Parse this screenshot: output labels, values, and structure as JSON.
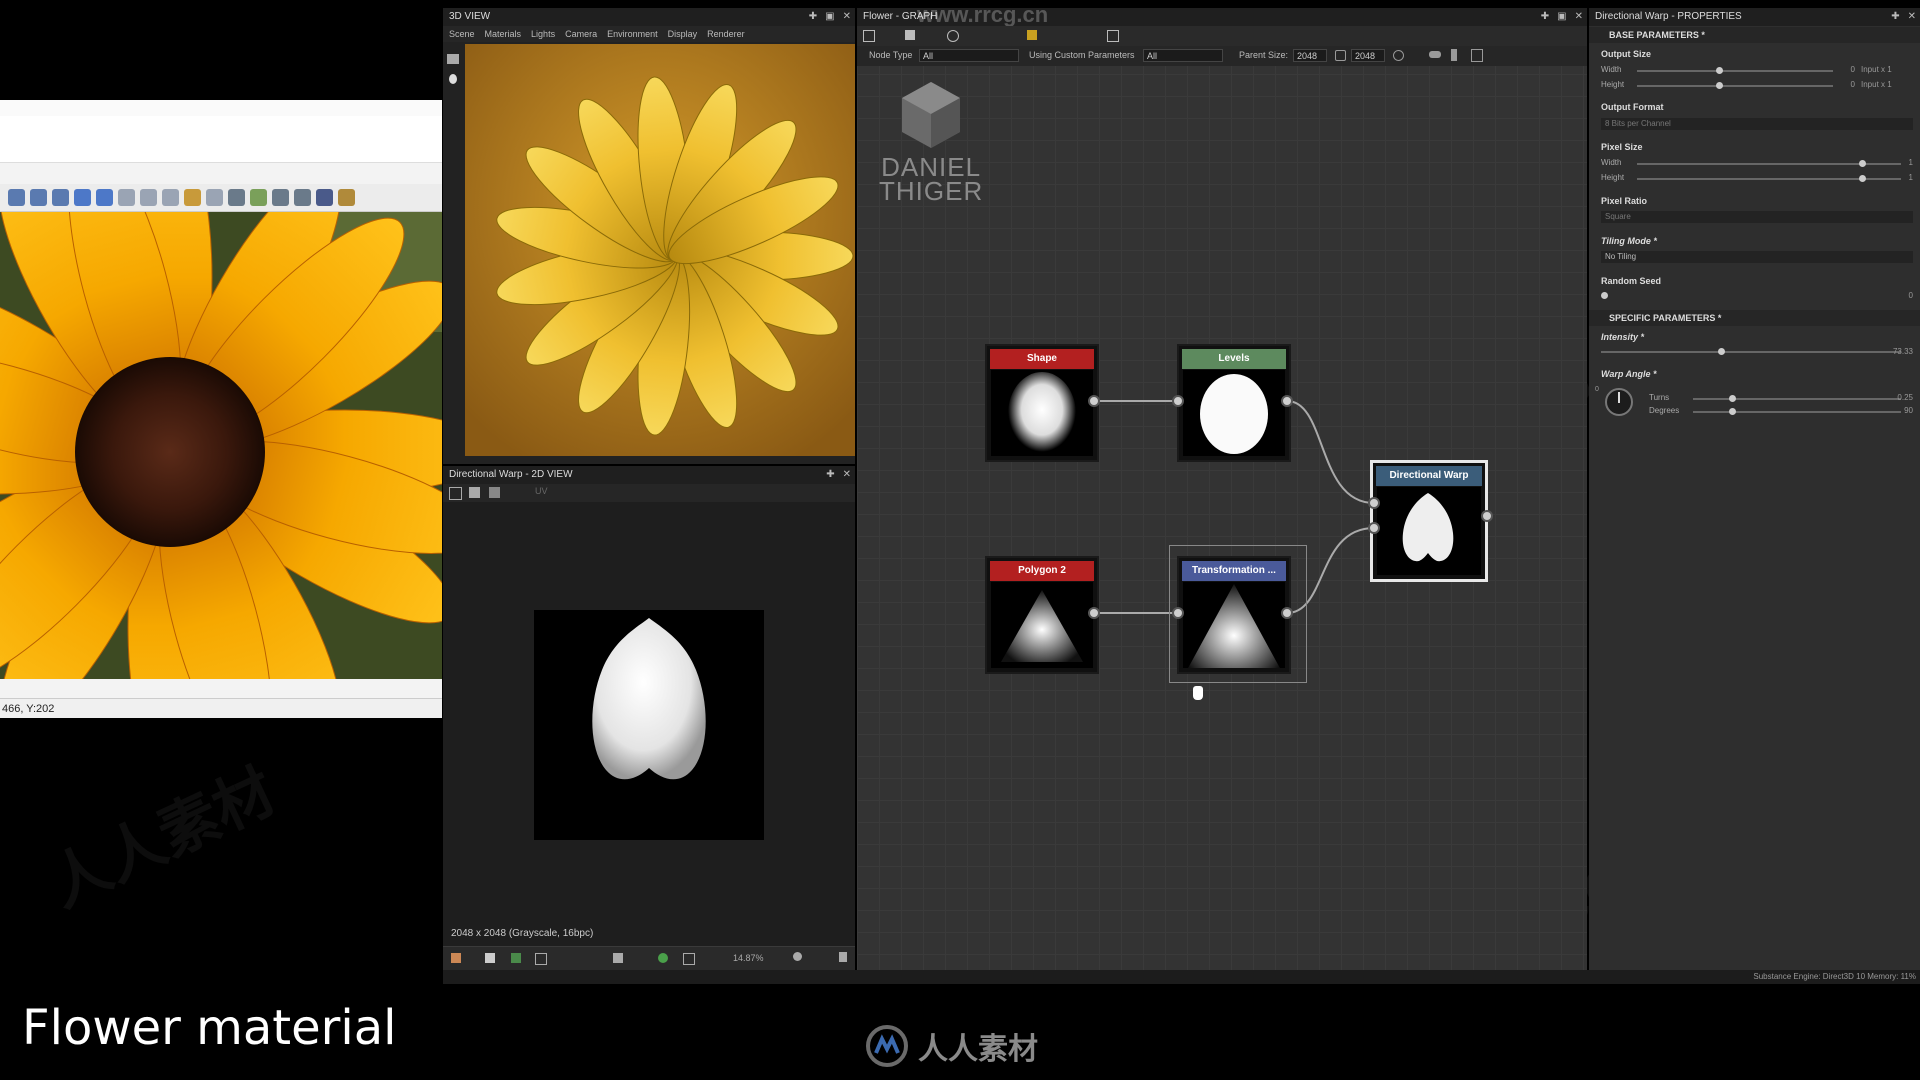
{
  "viewer": {
    "status_text": "466, Y:202"
  },
  "view3d": {
    "title": "3D VIEW",
    "menu": [
      "Scene",
      "Materials",
      "Lights",
      "Camera",
      "Environment",
      "Display",
      "Renderer"
    ]
  },
  "view2d": {
    "title": "Directional Warp - 2D VIEW",
    "uv_label": "UV",
    "info": "2048 x 2048 (Grayscale, 16bpc)",
    "zoom": "14.87%"
  },
  "graph": {
    "title": "Flower - GRAPH",
    "watermark_url": "www.rrcg.cn",
    "node_type_label": "Node Type",
    "node_type_value": "All",
    "custom_params_label": "Using Custom Parameters",
    "custom_params_value": "All",
    "parent_size_label": "Parent Size:",
    "parent_size_value": "2048",
    "size_value": "2048",
    "logo_line1": "DANIEL",
    "logo_line2": "THIGER",
    "nodes": {
      "shape": {
        "title": "Shape",
        "color": "#b32020"
      },
      "levels": {
        "title": "Levels",
        "color": "#5d8a5e"
      },
      "polygon": {
        "title": "Polygon 2",
        "color": "#b32020"
      },
      "transform": {
        "title": "Transformation ...",
        "color": "#4a5a9a"
      },
      "warp": {
        "title": "Directional Warp",
        "color": "#3b5d7a"
      }
    }
  },
  "props": {
    "title": "Directional Warp - PROPERTIES",
    "base_section": "BASE PARAMETERS *",
    "output_size": "Output Size",
    "width_label": "Width",
    "height_label": "Height",
    "width_value": "0",
    "height_value": "0",
    "width_mode": "Input x 1",
    "height_mode": "Input x 1",
    "output_format": "Output Format",
    "output_format_value": "8 Bits per Channel",
    "pixel_size": "Pixel Size",
    "pixel_width_value": "1",
    "pixel_height_value": "1",
    "pixel_ratio": "Pixel Ratio",
    "pixel_ratio_value": "Square",
    "tiling_mode": "Tiling Mode *",
    "tiling_value": "No Tiling",
    "random_seed": "Random Seed",
    "random_seed_value": "0",
    "specific_section": "SPECIFIC PARAMETERS *",
    "intensity": "Intensity *",
    "intensity_value": "73.33",
    "intensity_fraction": 0.4,
    "warp_angle": "Warp Angle *",
    "turns_label": "Turns",
    "turns_value": "0.25",
    "degrees_label": "Degrees",
    "degrees_value": "90",
    "dial_zero": "0"
  },
  "caption": "Flower material",
  "brand": "人人素材",
  "status_bar": "Substance Engine: Direct3D 10   Memory: 11%",
  "watermarks": [
    "RRCG",
    "人人素材"
  ]
}
